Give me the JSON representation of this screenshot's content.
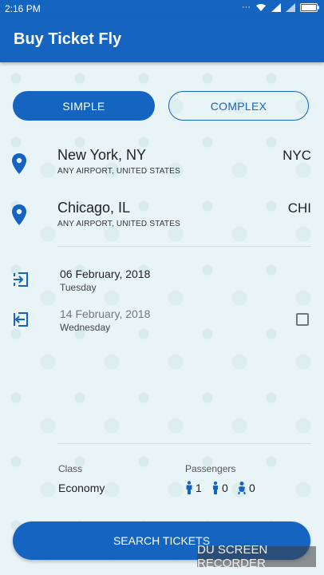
{
  "status_bar": {
    "time": "2:16 PM",
    "battery": ""
  },
  "app_bar": {
    "title": "Buy Ticket Fly"
  },
  "trip_type": {
    "simple_label": "SIMPLE",
    "complex_label": "COMPLEX",
    "selected": "SIMPLE"
  },
  "origin": {
    "city": "New York, NY",
    "subtitle": "ANY AIRPORT, UNITED STATES",
    "code": "NYC"
  },
  "destination": {
    "city": "Chicago, IL",
    "subtitle": "ANY AIRPORT, UNITED STATES",
    "code": "CHI"
  },
  "departure": {
    "date": "06 February, 2018",
    "day": "Tuesday"
  },
  "return": {
    "date": "14 February, 2018",
    "day": "Wednesday",
    "enabled": false
  },
  "class": {
    "label": "Class",
    "value": "Economy"
  },
  "passengers": {
    "label": "Passengers",
    "adults": "1",
    "children": "0",
    "infants": "0"
  },
  "search_button": {
    "label": "SEARCH TICKETS"
  },
  "watermark": {
    "text": "DU SCREEN RECORDER"
  },
  "colors": {
    "primary": "#1565c0",
    "background": "#e8f4f6"
  }
}
